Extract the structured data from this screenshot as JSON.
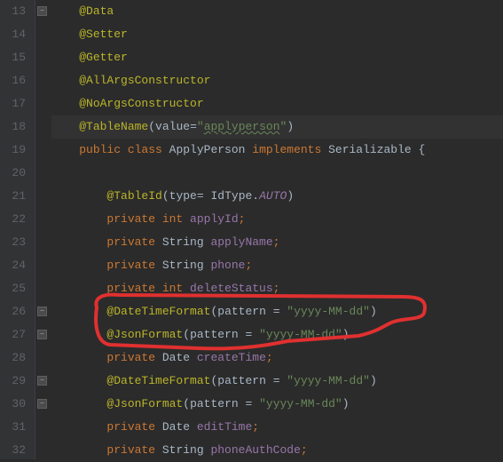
{
  "gutter": {
    "start": 13,
    "end": 32
  },
  "lines": {
    "l13": {
      "ann": "@Data"
    },
    "l14": {
      "ann": "@Setter"
    },
    "l15": {
      "ann": "@Getter"
    },
    "l16": {
      "ann": "@AllArgsConstructor"
    },
    "l17": {
      "ann": "@NoArgsConstructor"
    },
    "l18": {
      "ann": "@TableName",
      "lp": "(",
      "param": "value",
      "eq": "=",
      "q1": "\"",
      "str": "applyperson",
      "q2": "\"",
      "rp": ")"
    },
    "l19": {
      "kw1": "public class ",
      "cls": "ApplyPerson ",
      "kw2": "implements ",
      "iface": "Serializable {"
    },
    "l20": {
      "blank": ""
    },
    "l21": {
      "ann": "@TableId",
      "lp": "(",
      "param": "type",
      "eq": "= ",
      "idtype": "IdType.",
      "auto": "AUTO",
      "rp": ")"
    },
    "l22": {
      "kw": "private int ",
      "field": "applyId",
      "semi": ";"
    },
    "l23": {
      "kw": "private ",
      "type": "String ",
      "field": "applyName",
      "semi": ";"
    },
    "l24": {
      "kw": "private ",
      "type": "String ",
      "field": "phone",
      "semi": ";"
    },
    "l25": {
      "kw": "private int ",
      "field": "deleteStatus",
      "semi": ";"
    },
    "l26": {
      "ann": "@DateTimeFormat",
      "lp": "(",
      "param": "pattern ",
      "eq": "= ",
      "q1": "\"",
      "str": "yyyy-MM-dd",
      "q2": "\"",
      "rp": ")"
    },
    "l27": {
      "ann": "@JsonFormat",
      "lp": "(",
      "param": "pattern ",
      "eq": "= ",
      "q1": "\"",
      "str": "yyyy-MM-dd",
      "q2": "\"",
      "rp": ")"
    },
    "l28": {
      "kw": "private ",
      "type": "Date ",
      "field": "createTime",
      "semi": ";"
    },
    "l29": {
      "ann": "@DateTimeFormat",
      "lp": "(",
      "param": "pattern ",
      "eq": "= ",
      "q1": "\"",
      "str": "yyyy-MM-dd",
      "q2": "\"",
      "rp": ")"
    },
    "l30": {
      "ann": "@JsonFormat",
      "lp": "(",
      "param": "pattern ",
      "eq": "= ",
      "q1": "\"",
      "str": "yyyy-MM-dd",
      "q2": "\"",
      "rp": ")"
    },
    "l31": {
      "kw": "private ",
      "type": "Date ",
      "field": "editTime",
      "semi": ";"
    },
    "l32": {
      "kw": "private ",
      "type": "String ",
      "field": "phoneAuthCode",
      "semi": ";"
    }
  },
  "fold_marks": [
    13,
    26,
    27,
    29,
    30
  ],
  "current_line": 18
}
